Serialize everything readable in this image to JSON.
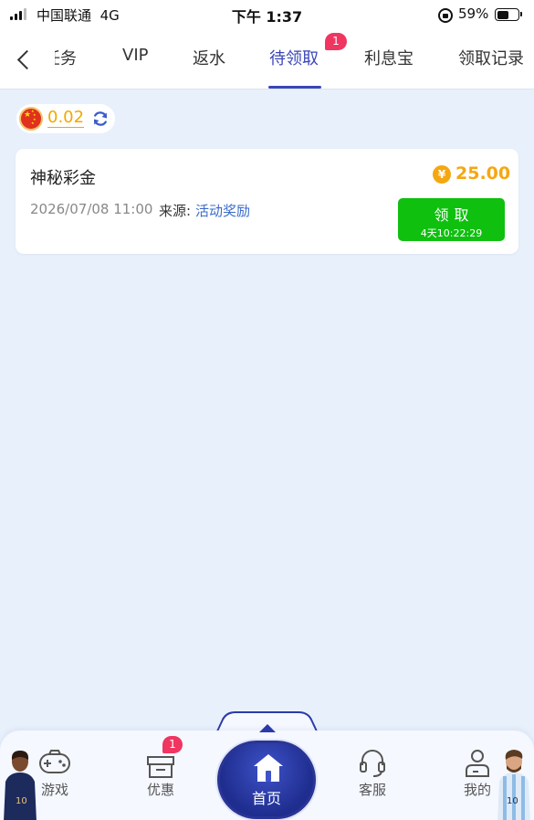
{
  "status_bar": {
    "carrier": "中国联通",
    "network": "4G",
    "time": "下午 1:37",
    "battery": "59%",
    "battery_level": 0.59
  },
  "tabs": [
    {
      "label": "任务",
      "active": false
    },
    {
      "label": "VIP",
      "active": false
    },
    {
      "label": "返水",
      "active": false
    },
    {
      "label": "待领取",
      "active": true,
      "badge": "1"
    },
    {
      "label": "利息宝",
      "active": false
    },
    {
      "label": "领取记录",
      "active": false
    }
  ],
  "balance": {
    "amount": "0.02",
    "currency_flag": "china-flag-icon"
  },
  "reward_card": {
    "title": "神秘彩金",
    "currency_symbol": "¥",
    "amount": "25.00",
    "date": "2026/07/08 11:00",
    "source_label": "来源:",
    "source_value": "活动奖励",
    "claim_button": {
      "label": "领取",
      "timer": "4天10:22:29"
    }
  },
  "bottom_nav": {
    "items": [
      {
        "label": "游戏",
        "icon": "gamepad-icon"
      },
      {
        "label": "优惠",
        "icon": "gift-icon",
        "badge": "1"
      },
      {
        "label": "首页",
        "icon": "home-icon"
      },
      {
        "label": "客服",
        "icon": "headset-icon"
      },
      {
        "label": "我的",
        "icon": "user-icon"
      }
    ]
  },
  "colors": {
    "accent": "#3a46b8",
    "badge": "#f03560",
    "gold": "#f5a712",
    "claim_green": "#0fc00f",
    "link": "#3a6bcb",
    "page_bg": "#e8f0fb"
  }
}
